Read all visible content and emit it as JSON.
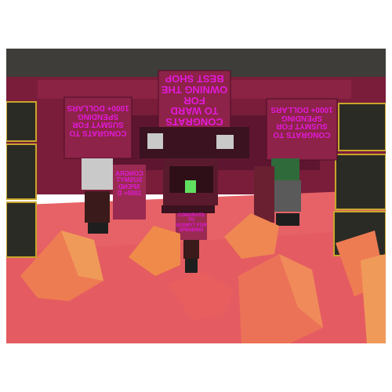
{
  "signs": {
    "top_center": "CONGRATS\nTO WARD FOR\nOWNING THE\nBEST SHOP",
    "left": "CONGRATS TO\nSUSMYT FOR\nSPENDING\n1000+ DOLLARS",
    "right": "CONGRATS TO\nSUSMYT FOR\nSPENDING\n1000+ DOLLARS",
    "small_left": "CONGRA\nSUSMYT\nSPEND\n1000+ D",
    "center_small": "CONGRATS\nTO\nSUSMYT FOR\nSPENDING"
  },
  "colors": {
    "sky": "#4a4a48",
    "wall": "#7b1d3a",
    "floor": "#e56467",
    "sign_text": "#e21ad8",
    "sign_bg": "#8d2348",
    "crate_orange": "#f08a4a",
    "speaker": "#2b2b26",
    "speaker_trim": "#c7a62a"
  }
}
